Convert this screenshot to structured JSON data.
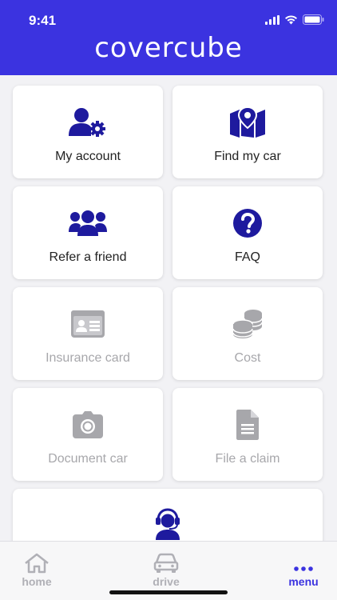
{
  "status": {
    "time": "9:41"
  },
  "header": {
    "brand": "covercube"
  },
  "menu": {
    "my_account": "My account",
    "find_my_car": "Find my car",
    "refer_a_friend": "Refer a friend",
    "faq": "FAQ",
    "insurance_card": "Insurance card",
    "cost": "Cost",
    "document_car": "Document car",
    "file_a_claim": "File a claim"
  },
  "tabbar": {
    "home": "home",
    "drive": "drive",
    "menu": "menu"
  },
  "colors": {
    "brand": "#3b33e0",
    "icon_active": "#1e1a9e",
    "icon_disabled": "#a7a7ab"
  }
}
